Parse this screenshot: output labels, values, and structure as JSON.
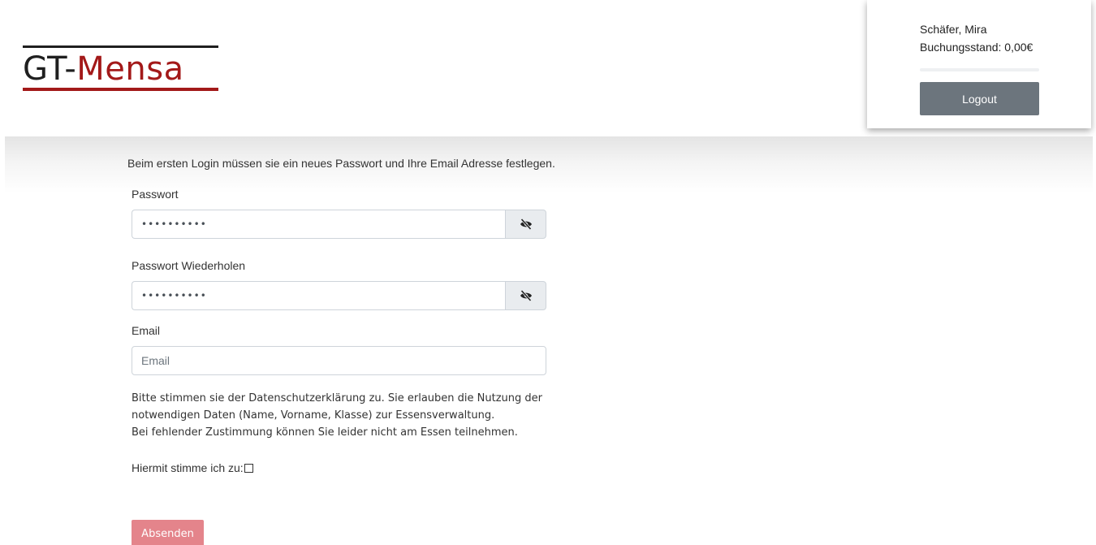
{
  "header": {
    "logo": {
      "gt": "GT",
      "dash": "-",
      "mensa": "Mensa"
    },
    "user": {
      "name": "Schäfer, Mira",
      "balance": "Buchungsstand: 0,00€",
      "logout_label": "Logout"
    }
  },
  "form": {
    "intro": "Beim ersten Login müssen sie ein neues Passwort und Ihre Email Adresse festlegen.",
    "password_label": "Passwort",
    "password_value": "••••••••••",
    "password_repeat_label": "Passwort Wiederholen",
    "password_repeat_value": "••••••••••",
    "email_label": "Email",
    "email_placeholder": "Email",
    "consent_lines": [
      "Bitte stimmen sie der Datenschutzerklärung zu. Sie erlauben die Nutzung der",
      "notwendigen Daten (Name, Vorname, Klasse) zur Essensverwaltung.",
      "Bei fehlender Zustimmung können Sie leider nicht am Essen teilnehmen."
    ],
    "agree_label": "Hiermit stimme ich zu:",
    "agree_checked": false,
    "submit_label": "Absenden"
  },
  "icons": {
    "password_toggle": "eye-slash-icon",
    "password_repeat_toggle": "eye-slash-icon"
  },
  "colors": {
    "brand_red": "#a31919",
    "logout_button": "#6c757d",
    "submit_button": "#e4848b"
  }
}
